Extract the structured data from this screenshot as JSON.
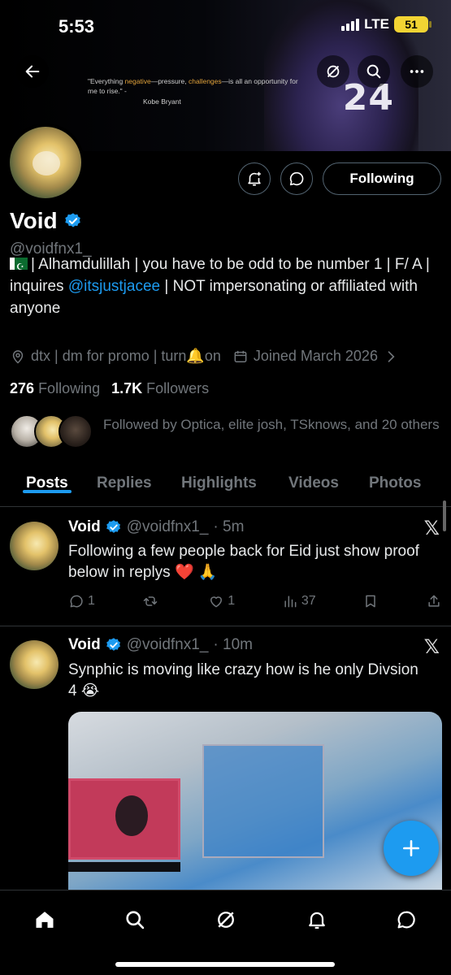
{
  "status_bar": {
    "time": "5:53",
    "network": "LTE",
    "battery": "51"
  },
  "banner": {
    "quote_text_pre": "\"Everything ",
    "quote_hl1": "negative",
    "quote_mid1": "—pressure, ",
    "quote_hl2": "challenges",
    "quote_rest": "—is all an opportunity for me to rise.\" -",
    "quote_author": "Kobe Bryant",
    "jersey_number": "24"
  },
  "profile": {
    "display_name": "Void",
    "handle": "@voidfnx1_",
    "bio_part1": "| Alhamdulillah | you have to be odd to be number 1 | F/ A | inquires ",
    "bio_link": "@itsjustjacee",
    "bio_part2": " | NOT impersonating or affiliated with anyone",
    "location": "dtx | dm for promo | turn🔔on",
    "joined": "Joined March 2026",
    "following_count": "276",
    "following_label": "Following",
    "followers_count": "1.7K",
    "followers_label": "Followers",
    "followed_by": "Followed by Optica, elite josh, TSknows, and 20 others",
    "follow_button": "Following"
  },
  "tabs": [
    {
      "label": "Posts",
      "active": true
    },
    {
      "label": "Replies",
      "active": false
    },
    {
      "label": "Highlights",
      "active": false
    },
    {
      "label": "Videos",
      "active": false
    },
    {
      "label": "Photos",
      "active": false
    }
  ],
  "posts": [
    {
      "name": "Void",
      "handle": "@voidfnx1_",
      "time": "· 5m",
      "text": "Following a few people back for Eid just show proof below in replys ❤️ 🙏",
      "replies": "1",
      "reposts": "",
      "likes": "1",
      "views": "37"
    },
    {
      "name": "Void",
      "handle": "@voidfnx1_",
      "time": "· 10m",
      "text": "Synphic is moving like crazy how is he only Divsion 4 😭"
    }
  ],
  "icons": {
    "x_logo": "𝕏"
  },
  "colors": {
    "accent": "#1d9bf0",
    "muted": "#71767b",
    "background": "#000000"
  }
}
